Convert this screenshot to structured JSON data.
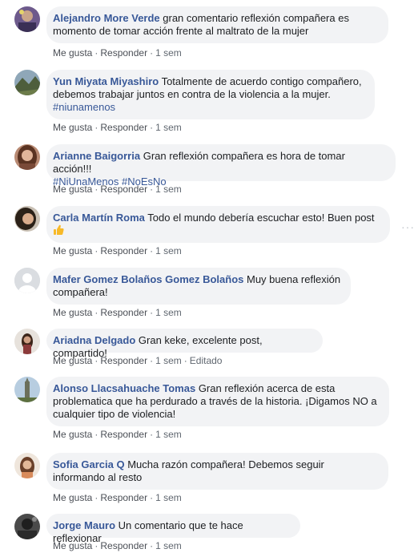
{
  "comments": [
    {
      "author": "Alejandro More Verde",
      "text": " gran comentario reflexión compañera es momento de tomar acción frente al maltrato de la mujer",
      "hashtags": "",
      "like": "Me gusta",
      "reply": "Responder",
      "time": "1 sem",
      "extra": ""
    },
    {
      "author": "Yun Miyata Miyashiro",
      "text": " Totalmente de acuerdo contigo compañero, debemos trabajar juntos en contra de la violencia a la mujer.",
      "hashtags": "#niunamenos",
      "like": "Me gusta",
      "reply": "Responder",
      "time": "1 sem",
      "extra": ""
    },
    {
      "author": "Arianne Baigorria",
      "text": " Gran reflexión compañera es hora de tomar acción!!!",
      "hashtags": "#NiUnaMenos #NoEsNo",
      "like": "Me gusta",
      "reply": "Responder",
      "time": "1 sem",
      "extra": ""
    },
    {
      "author": "Carla Martín Roma",
      "text": " Todo el mundo debería escuchar esto! Buen post",
      "hashtags": "",
      "like": "Me gusta",
      "reply": "Responder",
      "time": "1 sem",
      "extra": "",
      "more": "···"
    },
    {
      "author": "Mafer Gomez Bolaños Gomez Bolaños",
      "text": " Muy buena reflexión compañera!",
      "hashtags": "",
      "like": "Me gusta",
      "reply": "Responder",
      "time": "1 sem",
      "extra": ""
    },
    {
      "author": "Ariadna Delgado",
      "text": " Gran keke, excelente post, compartido!",
      "hashtags": "",
      "like": "Me gusta",
      "reply": "Responder",
      "time": "1 sem",
      "extra": "Editado"
    },
    {
      "author": "Alonso Llacsahuache Tomas",
      "text": " Gran reflexión acerca de esta problematica que ha perdurado a través de la historia. ¡Digamos NO a cualquier tipo de violencia!",
      "hashtags": "",
      "like": "Me gusta",
      "reply": "Responder",
      "time": "1 sem",
      "extra": ""
    },
    {
      "author": "Sofia Garcia Q",
      "text": " Mucha razón compañera! Debemos seguir informando al resto",
      "hashtags": "",
      "like": "Me gusta",
      "reply": "Responder",
      "time": "1 sem",
      "extra": ""
    },
    {
      "author": "Jorge Mauro",
      "text": " Un comentario que te hace reflexionar",
      "hashtags": "",
      "like": "Me gusta",
      "reply": "Responder",
      "time": "1 sem",
      "extra": ""
    }
  ],
  "colors": {
    "author": "#385898",
    "bubble": "#f2f3f5",
    "meta": "#606770"
  }
}
